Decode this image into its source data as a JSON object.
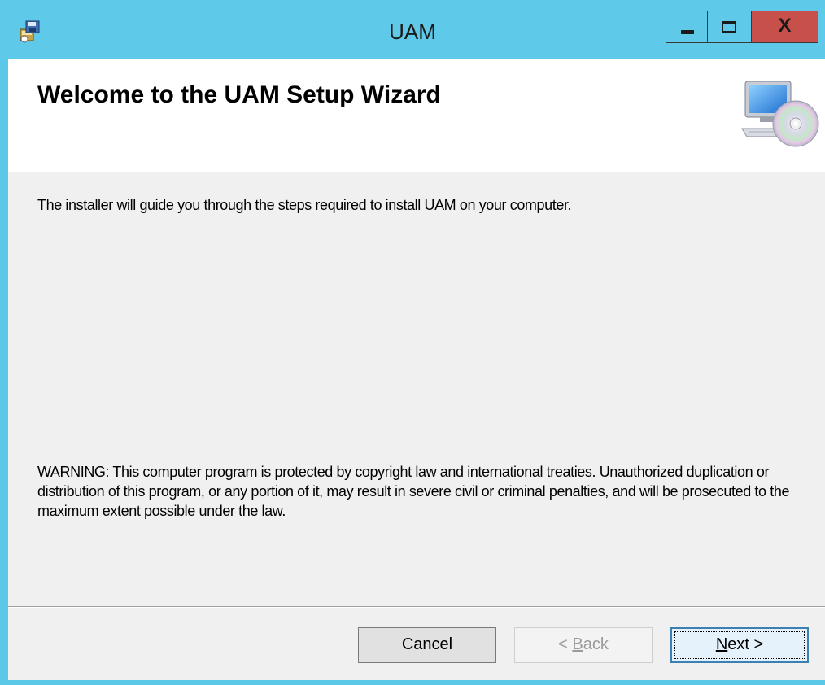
{
  "window": {
    "title": "UAM",
    "controls": {
      "minimize": "minimize-icon",
      "maximize": "maximize-icon",
      "close": "X"
    },
    "colors": {
      "titlebar": "#5ec9e8",
      "close_button": "#c7504a",
      "client": "#f0f0f0"
    }
  },
  "banner": {
    "title": "Welcome to the UAM Setup Wizard",
    "graphic": "computer-cd-icon"
  },
  "body": {
    "intro": "The installer will guide you through the steps required to install UAM on your computer.",
    "warning": "WARNING: This computer program is protected by copyright law and international treaties. Unauthorized duplication or distribution of this program, or any portion of it, may result in severe civil or criminal penalties, and will be prosecuted to the maximum extent possible under the law."
  },
  "buttons": {
    "cancel": "Cancel",
    "back_prefix": "< ",
    "back_mnemonic": "B",
    "back_rest": "ack",
    "back_enabled": false,
    "next_mnemonic": "N",
    "next_rest": "ext >",
    "next_default": true
  }
}
